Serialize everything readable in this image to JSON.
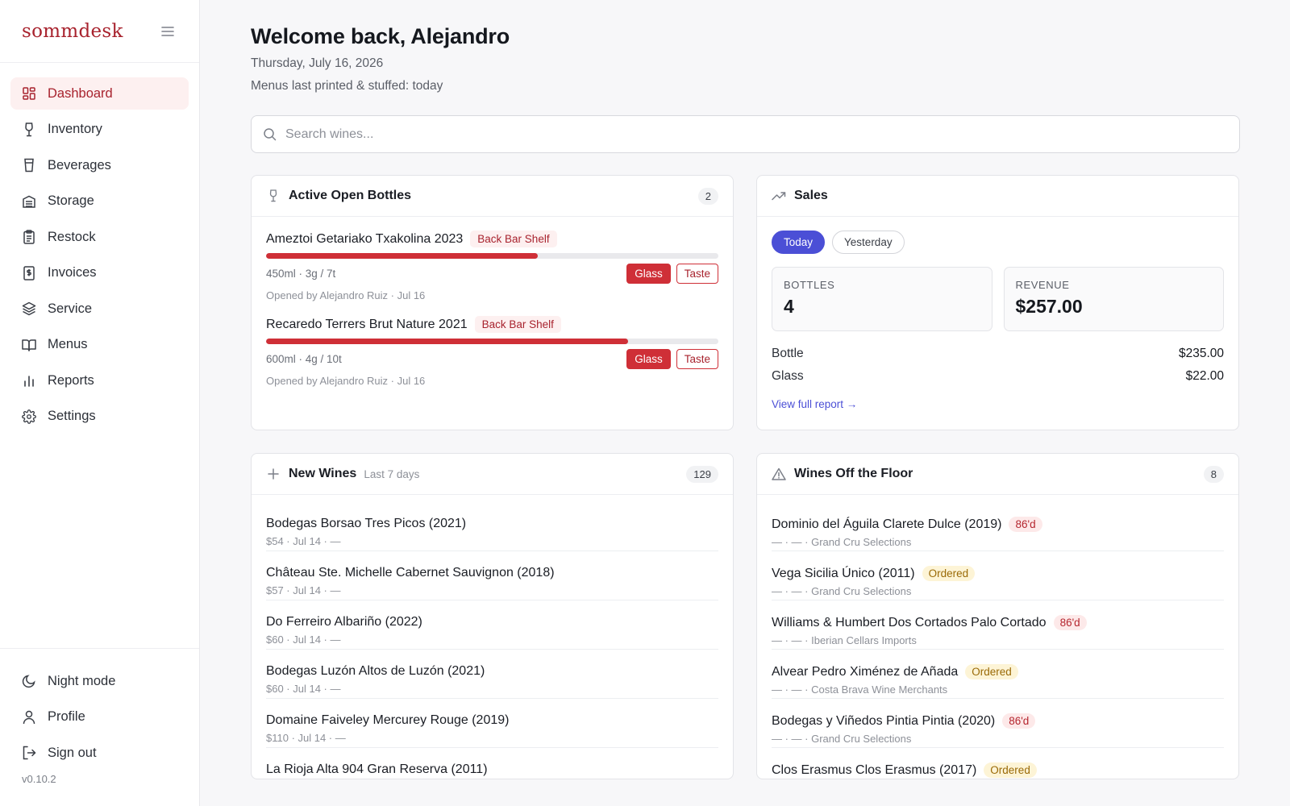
{
  "sidebar": {
    "brand": "sommdesk",
    "items": [
      {
        "label": "Dashboard",
        "icon": "dashboard-grid-icon",
        "active": true
      },
      {
        "label": "Inventory",
        "icon": "wine-glass-icon"
      },
      {
        "label": "Beverages",
        "icon": "cup-icon"
      },
      {
        "label": "Storage",
        "icon": "storage-icon"
      },
      {
        "label": "Restock",
        "icon": "clipboard-icon"
      },
      {
        "label": "Invoices",
        "icon": "invoice-icon"
      },
      {
        "label": "Service",
        "icon": "layers-icon"
      },
      {
        "label": "Menus",
        "icon": "book-icon"
      },
      {
        "label": "Reports",
        "icon": "bar-chart-icon"
      },
      {
        "label": "Settings",
        "icon": "gear-icon"
      }
    ],
    "bottom": {
      "night_mode": "Night mode",
      "profile": "Profile",
      "sign_out": "Sign out",
      "version": "v0.10.2"
    }
  },
  "header": {
    "welcome": "Welcome back, Alejandro",
    "date": "Thursday, July 16, 2026",
    "printed": "Menus last printed & stuffed: today"
  },
  "search": {
    "placeholder": "Search wines..."
  },
  "open_bottles": {
    "title": "Active Open Bottles",
    "count": "2",
    "glass_label": "Glass",
    "taste_label": "Taste",
    "items": [
      {
        "name": "Ameztoi Getariako Txakolina 2023",
        "location": "Back Bar Shelf",
        "meta": "450ml · 3g / 7t",
        "opened": "Opened by Alejandro Ruiz · Jul 16",
        "remaining": 0.6
      },
      {
        "name": "Recaredo Terrers Brut Nature 2021",
        "location": "Back Bar Shelf",
        "meta": "600ml · 4g / 10t",
        "opened": "Opened by Alejandro Ruiz · Jul 16",
        "remaining": 0.8
      }
    ]
  },
  "sales": {
    "title": "Sales",
    "tabs": [
      "Today",
      "Yesterday"
    ],
    "bottles_label": "BOTTLES",
    "bottles_value": "4",
    "revenue_label": "REVENUE",
    "revenue_value": "$257.00",
    "rows": [
      {
        "label": "Bottle",
        "amount": "$235.00"
      },
      {
        "label": "Glass",
        "amount": "$22.00"
      }
    ],
    "report_link": "View full report →"
  },
  "new_wines": {
    "title": "New Wines",
    "subtitle": "Last 7 days",
    "count": "129",
    "items": [
      {
        "name": "Bodegas Borsao Tres Picos (2021)",
        "sub": "$54 · Jul 14 · —"
      },
      {
        "name": "Château Ste. Michelle Cabernet Sauvignon (2018)",
        "sub": "$57 · Jul 14 · —"
      },
      {
        "name": "Do Ferreiro Albariño (2022)",
        "sub": "$60 · Jul 14 · —"
      },
      {
        "name": "Bodegas Luzón Altos de Luzón (2021)",
        "sub": "$60 · Jul 14 · —"
      },
      {
        "name": "Domaine Faiveley Mercurey Rouge (2019)",
        "sub": "$110 · Jul 14 · —"
      },
      {
        "name": "La Rioja Alta 904 Gran Reserva (2011)",
        "sub": ""
      }
    ]
  },
  "off_floor": {
    "title": "Wines Off the Floor",
    "count": "8",
    "items": [
      {
        "name": "Dominio del Águila Clarete Dulce (2019)",
        "tag": "86'd",
        "sub": "— · — · Grand Cru Selections"
      },
      {
        "name": "Vega Sicilia Único (2011)",
        "tag": "Ordered",
        "sub": "— · — · Grand Cru Selections"
      },
      {
        "name": "Williams & Humbert Dos Cortados Palo Cortado",
        "tag": "86'd",
        "sub": "— · — · Iberian Cellars Imports"
      },
      {
        "name": "Alvear Pedro Ximénez de Añada",
        "tag": "Ordered",
        "sub": "— · — · Costa Brava Wine Merchants"
      },
      {
        "name": "Bodegas y Viñedos Pintia Pintia (2020)",
        "tag": "86'd",
        "sub": "— · — · Grand Cru Selections"
      },
      {
        "name": "Clos Erasmus Clos Erasmus (2017)",
        "tag": "Ordered",
        "sub": ""
      }
    ]
  },
  "colors": {
    "brand": "#a8232e",
    "accent": "#4b4fd6",
    "danger": "#cf2f37"
  }
}
